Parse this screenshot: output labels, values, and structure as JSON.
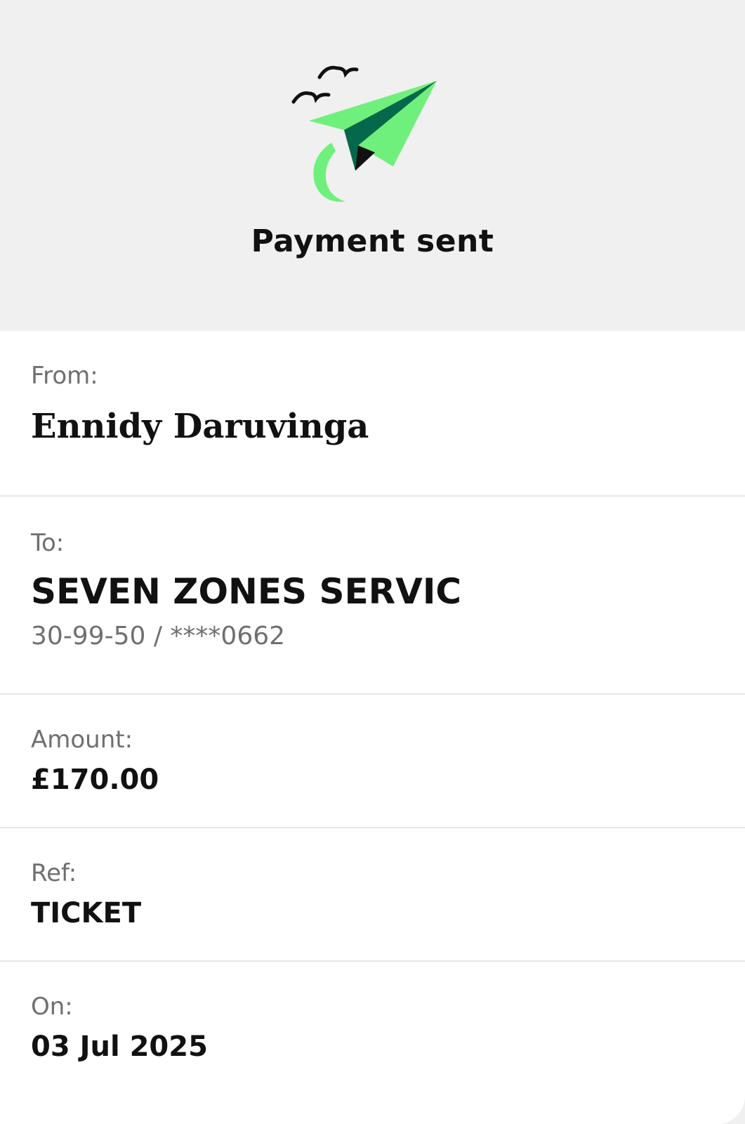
{
  "header": {
    "title": "Payment sent",
    "illustration_icon": "paper-plane-birds-icon",
    "colors": {
      "plane_light": "#6ff07c",
      "plane_dark": "#05684a",
      "background": "#f0f0f0"
    }
  },
  "details": {
    "from": {
      "label": "From:",
      "value": "Ennidy Daruvinga"
    },
    "to": {
      "label": "To:",
      "value": "SEVEN ZONES SERVIC",
      "account": "30-99-50 / ****0662"
    },
    "amount": {
      "label": "Amount:",
      "value": "£170.00"
    },
    "ref": {
      "label": "Ref:",
      "value": "TICKET"
    },
    "on": {
      "label": "On:",
      "value": "03 Jul 2025"
    }
  }
}
